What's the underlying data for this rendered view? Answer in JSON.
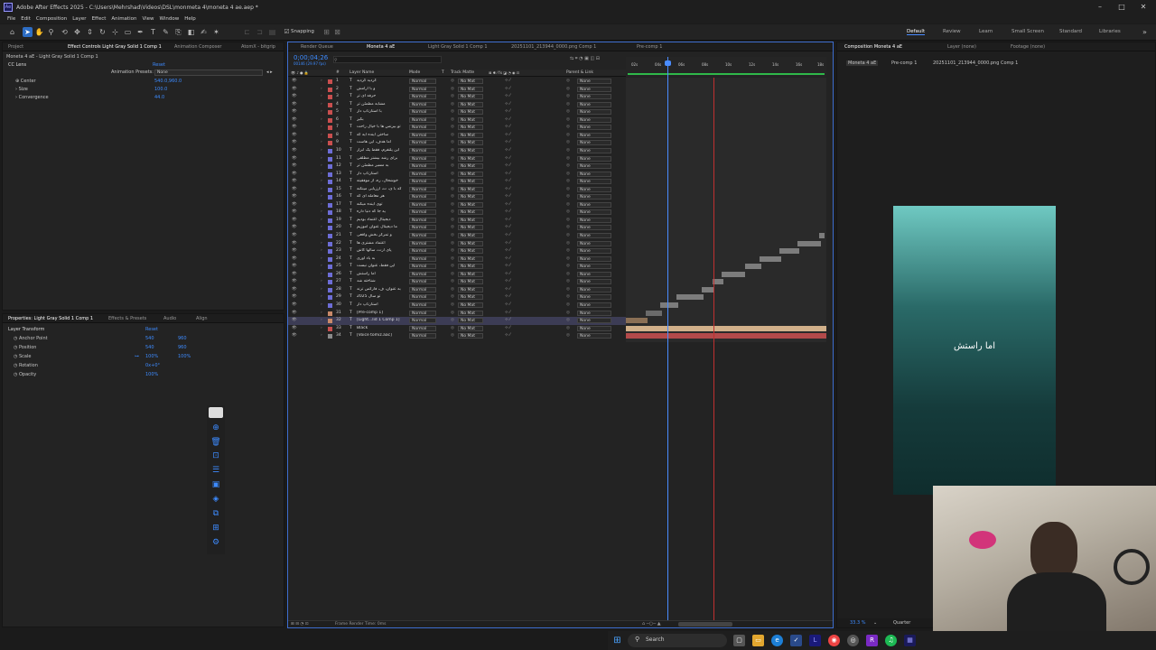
{
  "window": {
    "title": "Adobe After Effects 2025 - C:\\Users\\Mehrshad\\Videos\\DSL\\monmeta 4\\moneta 4 ae.aep *",
    "app_badge": "Ae"
  },
  "menu": [
    "File",
    "Edit",
    "Composition",
    "Layer",
    "Effect",
    "Animation",
    "View",
    "Window",
    "Help"
  ],
  "toolbar": {
    "snapping_label": "Snapping"
  },
  "workspaces": [
    "Default",
    "Review",
    "Learn",
    "Small Screen",
    "Standard",
    "Libraries"
  ],
  "left_top": {
    "tabs": [
      "Project",
      "Effect Controls Light Gray Solid 1 Comp 1",
      "Animation Composer",
      "AtomX - bitgrip"
    ],
    "breadcrumb": "Moneta 4 aE - Light Gray Solid 1 Comp 1",
    "effect_name": "CC Lens",
    "reset": "Reset",
    "presets_label": "Animation Presets:",
    "presets_value": "None",
    "props": [
      {
        "name": "Center",
        "value": "540.0,960.0"
      },
      {
        "name": "Size",
        "value": "100.0"
      },
      {
        "name": "Convergence",
        "value": "44.0"
      }
    ]
  },
  "left_bottom": {
    "tabs": [
      "Properties: Light Gray Solid 1 Comp 1",
      "Effects & Presets",
      "Audio",
      "Align"
    ],
    "section": "Layer Transform",
    "reset": "Reset",
    "props": [
      {
        "name": "Anchor Point",
        "v1": "540",
        "v2": "960"
      },
      {
        "name": "Position",
        "v1": "540",
        "v2": "960"
      },
      {
        "name": "Scale",
        "v1": "100%",
        "v2": "100%"
      },
      {
        "name": "Rotation",
        "v1": "0x+0°",
        "v2": ""
      },
      {
        "name": "Opacity",
        "v1": "100%",
        "v2": ""
      }
    ]
  },
  "timeline": {
    "tabs": [
      "Render Queue",
      "Moneta 4 aE",
      "Light Gray Solid 1 Comp 1",
      "20251101_213944_0000.png Comp 1",
      "Pre-comp 1"
    ],
    "timecode": "0;00;04;26",
    "timecode_sub": "00146 (29.97 fps)",
    "headers": {
      "num": "#",
      "name": "Layer Name",
      "mode": "Mode",
      "t": "T",
      "trkmat": "Track Matte",
      "parent": "Parent & Link"
    },
    "mode_value": "Normal",
    "matte_value": "No Mat",
    "parent_value": "None",
    "ruler": [
      "02s",
      "04s",
      "06s",
      "08s",
      "10s",
      "12s",
      "14s",
      "16s",
      "18s"
    ],
    "layers": [
      {
        "n": "1",
        "name": "کردید کردید",
        "color": "#c94f4f"
      },
      {
        "n": "2",
        "name": "و با آرامش",
        "color": "#c94f4f"
      },
      {
        "n": "3",
        "name": "حرفه ای تر",
        "color": "#c94f4f"
      },
      {
        "n": "4",
        "name": "مشابه مطمئن تر",
        "color": "#c94f4f"
      },
      {
        "n": "5",
        "name": "با استارتاپ دار",
        "color": "#c94f4f"
      },
      {
        "n": "6",
        "name": "بگیر",
        "color": "#c94f4f"
      },
      {
        "n": "7",
        "name": "تو بیزنس ها با خیال راحت",
        "color": "#c94f4f"
      },
      {
        "n": "8",
        "name": "ساختن آینده ایه که",
        "color": "#c94f4f"
      },
      {
        "n": "9",
        "name": "اما هدف، این هاست",
        "color": "#c94f4f"
      },
      {
        "n": "10",
        "name": "این پلتفرم، فقط یک ابزار",
        "color": "#6d6dd6"
      },
      {
        "n": "11",
        "name": "برای رشد بیشتر مطلقی",
        "color": "#6d6dd6"
      },
      {
        "n": "12",
        "name": "به مسیر مطمئن تر",
        "color": "#6d6dd6"
      },
      {
        "n": "13",
        "name": "استارتاپ دار",
        "color": "#6d6dd6"
      },
      {
        "n": "14",
        "name": "خوشحال، ره، از موفقیته",
        "color": "#6d6dd6"
      },
      {
        "n": "15",
        "name": "که با ی، ت، ارزیابی مینکنه",
        "color": "#6d6dd6"
      },
      {
        "n": "16",
        "name": "هر معامله ای که",
        "color": "#6d6dd6"
      },
      {
        "n": "17",
        "name": "توی آینده میکنه",
        "color": "#6d6dd6"
      },
      {
        "n": "18",
        "name": "یه جا که دنیا داره",
        "color": "#6d6dd6"
      },
      {
        "n": "19",
        "name": "دیجیتال اعتماد بودیم",
        "color": "#6d6dd6"
      },
      {
        "n": "20",
        "name": "ما دیجیتال عنوان اموزیم",
        "color": "#6d6dd6"
      },
      {
        "n": "21",
        "name": "و تمرکز بخشِ واقعی",
        "color": "#6d6dd6"
      },
      {
        "n": "22",
        "name": "اعتماد مشتری ها",
        "color": "#6d6dd6"
      },
      {
        "n": "23",
        "name": "پای آرت، سالها کاش",
        "color": "#6d6dd6"
      },
      {
        "n": "24",
        "name": "به یاد آوری",
        "color": "#6d6dd6"
      },
      {
        "n": "25",
        "name": "این فقط، عنوان نیست",
        "color": "#6d6dd6"
      },
      {
        "n": "26",
        "name": "اما راستش",
        "color": "#6d6dd6"
      },
      {
        "n": "27",
        "name": "شناخته شد",
        "color": "#6d6dd6"
      },
      {
        "n": "28",
        "name": "به عنوان، ف، فارکس ترند",
        "color": "#6d6dd6"
      },
      {
        "n": "29",
        "name": "تو سال 2025",
        "color": "#6d6dd6"
      },
      {
        "n": "30",
        "name": "استارتاپ دار",
        "color": "#6d6dd6"
      },
      {
        "n": "31",
        "name": "[Pre-comp 1]",
        "color": "#c98a6a"
      },
      {
        "n": "32",
        "name": "[Light...lid 1 Comp 1]",
        "color": "#c98a6a"
      },
      {
        "n": "33",
        "name": "Black",
        "color": "#c94f4f"
      },
      {
        "n": "34",
        "name": "[Voice tomiz.aac]",
        "color": "#8a8a8a"
      }
    ],
    "footer": "Frame Render Time: 0ms"
  },
  "comp_panel": {
    "tabs": [
      "Composition Moneta 4 aE",
      "Layer (none)",
      "Footage (none)"
    ],
    "crumbs": [
      "Moneta 4 aE",
      "Pre-comp 1",
      "20251101_213944_0000.png Comp 1"
    ],
    "caption": "اما راستش",
    "zoom": "33.3 %",
    "resolution": "Quarter"
  },
  "taskbar": {
    "search_placeholder": "Search"
  }
}
